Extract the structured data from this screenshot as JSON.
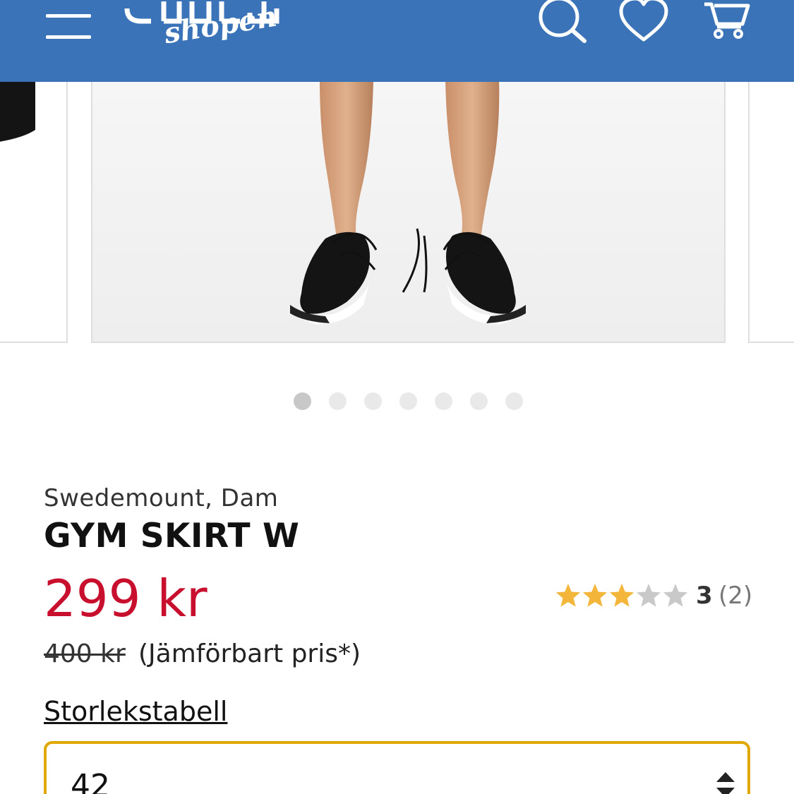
{
  "header": {
    "logo_text": "shopen",
    "colors": {
      "background": "#3a73b7",
      "icon": "#ffffff"
    },
    "icons": [
      "menu-icon",
      "search-icon",
      "heart-icon",
      "cart-icon"
    ]
  },
  "gallery": {
    "dot_count": 7,
    "active_index": 0
  },
  "product": {
    "brand": "Swedemount, Dam",
    "title": "GYM SKIRT W",
    "price": "299 kr",
    "old_price": "400 kr",
    "compare_note": "(Jämförbart pris*)",
    "rating": {
      "value": "3",
      "count": "(2)",
      "stars_filled": 3,
      "stars_total": 5
    },
    "size_table_link": "Storlekstabell",
    "selected_size": "42"
  },
  "colors": {
    "price": "#c8102e",
    "star_filled": "#f3b63b",
    "star_empty": "#c9c9c9",
    "select_border": "#e0a800"
  }
}
